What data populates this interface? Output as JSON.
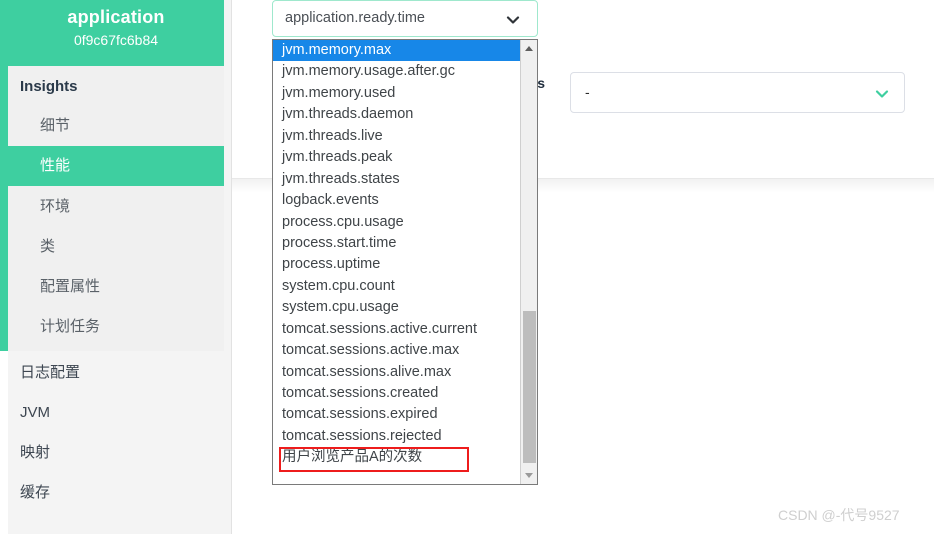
{
  "app": {
    "accent_green": "#3ecfa0",
    "select_highlight_blue": "#1787e8",
    "annotation_red": "#ee1c1c"
  },
  "sidebar": {
    "header": {
      "title": "application",
      "instance_id": "0f9c67fc6b84"
    },
    "group": {
      "title": "Insights",
      "items": [
        {
          "label": "细节",
          "active": false
        },
        {
          "label": "性能",
          "active": true
        },
        {
          "label": "环境",
          "active": false
        },
        {
          "label": "类",
          "active": false
        },
        {
          "label": "配置属性",
          "active": false
        },
        {
          "label": "计划任务",
          "active": false
        }
      ]
    },
    "top_items": [
      {
        "label": "日志配置"
      },
      {
        "label": "JVM"
      },
      {
        "label": "映射"
      },
      {
        "label": "缓存"
      }
    ]
  },
  "main": {
    "metric_select": {
      "value": "application.ready.time",
      "icon": "chevron-down-icon",
      "expanded": true,
      "options": [
        {
          "label": "jvm.memory.max",
          "selected": true
        },
        {
          "label": "jvm.memory.usage.after.gc",
          "selected": false
        },
        {
          "label": "jvm.memory.used",
          "selected": false
        },
        {
          "label": "jvm.threads.daemon",
          "selected": false
        },
        {
          "label": "jvm.threads.live",
          "selected": false
        },
        {
          "label": "jvm.threads.peak",
          "selected": false
        },
        {
          "label": "jvm.threads.states",
          "selected": false
        },
        {
          "label": "logback.events",
          "selected": false
        },
        {
          "label": "process.cpu.usage",
          "selected": false
        },
        {
          "label": "process.start.time",
          "selected": false
        },
        {
          "label": "process.uptime",
          "selected": false
        },
        {
          "label": "system.cpu.count",
          "selected": false
        },
        {
          "label": "system.cpu.usage",
          "selected": false
        },
        {
          "label": "tomcat.sessions.active.current",
          "selected": false
        },
        {
          "label": "tomcat.sessions.active.max",
          "selected": false
        },
        {
          "label": "tomcat.sessions.alive.max",
          "selected": false
        },
        {
          "label": "tomcat.sessions.created",
          "selected": false
        },
        {
          "label": "tomcat.sessions.expired",
          "selected": false
        },
        {
          "label": "tomcat.sessions.rejected",
          "selected": false
        },
        {
          "label": "用户浏览产品A的次数",
          "selected": false,
          "annotated": true
        }
      ]
    },
    "tag_field": {
      "label": "ss",
      "value": "-",
      "icon": "chevron-down-icon"
    }
  },
  "watermark": {
    "text": "CSDN @-代号9527"
  }
}
